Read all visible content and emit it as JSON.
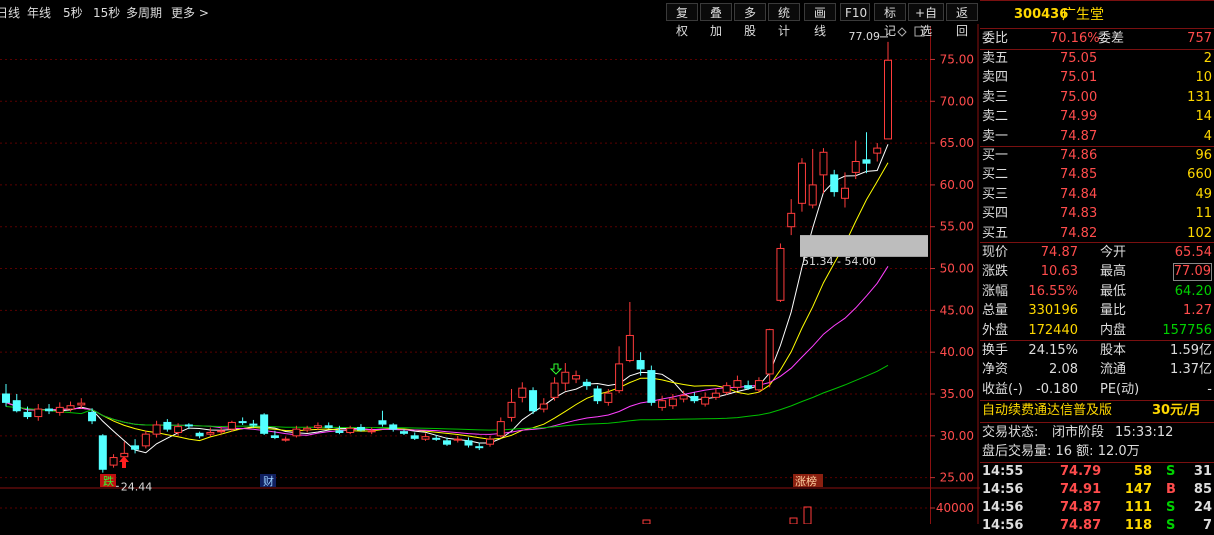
{
  "toolbar": {
    "periods": [
      "日线",
      "年线",
      "5秒",
      "15秒",
      "多周期",
      "更多 >"
    ],
    "buttons": [
      "复权",
      "叠加",
      "多股",
      "统计",
      "画线",
      "F10",
      "标记",
      "+自选",
      "返回"
    ]
  },
  "chart_data": {
    "type": "candlestick",
    "title": "",
    "ylim": [
      24,
      79
    ],
    "yticks": [
      25.0,
      30.0,
      35.0,
      40.0,
      45.0,
      50.0,
      55.0,
      60.0,
      65.0,
      70.0,
      75.0
    ],
    "candles": [
      [
        35.0,
        34.0,
        36.2,
        33.5
      ],
      [
        34.2,
        33.0,
        35.0,
        32.8
      ],
      [
        32.8,
        32.3,
        33.5,
        32.0
      ],
      [
        32.3,
        33.2,
        33.8,
        31.8
      ],
      [
        33.2,
        33.0,
        33.8,
        32.6
      ],
      [
        32.8,
        33.4,
        34.0,
        32.4
      ],
      [
        33.2,
        33.6,
        34.1,
        32.9
      ],
      [
        33.7,
        33.9,
        34.5,
        33.3
      ],
      [
        32.8,
        31.8,
        33.3,
        31.4
      ],
      [
        30.0,
        26.0,
        30.2,
        25.6
      ],
      [
        26.5,
        27.4,
        27.8,
        26.2
      ],
      [
        27.5,
        27.9,
        29.3,
        26.8
      ],
      [
        28.8,
        28.4,
        29.6,
        27.9
      ],
      [
        28.8,
        30.2,
        30.6,
        28.5
      ],
      [
        30.2,
        31.3,
        31.8,
        29.8
      ],
      [
        31.6,
        30.8,
        32.0,
        30.5
      ],
      [
        30.4,
        31.1,
        31.5,
        30.0
      ],
      [
        31.3,
        31.2,
        31.5,
        30.8
      ],
      [
        30.3,
        30.0,
        30.5,
        29.7
      ],
      [
        30.2,
        30.4,
        31.0,
        29.9
      ],
      [
        30.5,
        30.6,
        31.1,
        30.2
      ],
      [
        30.8,
        31.6,
        31.8,
        30.5
      ],
      [
        31.7,
        31.6,
        32.2,
        31.3
      ],
      [
        31.4,
        31.3,
        31.9,
        31.0
      ],
      [
        32.5,
        30.3,
        32.7,
        30.1
      ],
      [
        30.0,
        29.8,
        30.6,
        29.6
      ],
      [
        29.5,
        29.6,
        29.9,
        29.3
      ],
      [
        30.0,
        30.8,
        31.2,
        29.8
      ],
      [
        30.7,
        30.9,
        31.2,
        30.4
      ],
      [
        31.0,
        31.2,
        31.6,
        30.7
      ],
      [
        31.2,
        31.0,
        31.6,
        30.9
      ],
      [
        30.6,
        30.4,
        31.2,
        30.2
      ],
      [
        30.4,
        30.9,
        31.2,
        30.2
      ],
      [
        31.0,
        30.7,
        31.4,
        30.5
      ],
      [
        30.5,
        30.6,
        31.0,
        30.2
      ],
      [
        31.8,
        31.4,
        33.0,
        31.1
      ],
      [
        31.3,
        30.8,
        31.5,
        30.5
      ],
      [
        30.5,
        30.3,
        30.8,
        30.1
      ],
      [
        30.0,
        29.7,
        30.4,
        29.5
      ],
      [
        29.6,
        29.9,
        30.3,
        29.4
      ],
      [
        29.7,
        29.6,
        30.1,
        29.4
      ],
      [
        29.4,
        29.0,
        29.8,
        28.8
      ],
      [
        29.5,
        29.6,
        30.0,
        29.2
      ],
      [
        29.4,
        28.9,
        29.8,
        28.6
      ],
      [
        28.7,
        28.6,
        29.2,
        28.3
      ],
      [
        29.0,
        29.6,
        30.0,
        28.7
      ],
      [
        30.0,
        31.7,
        32.2,
        29.8
      ],
      [
        32.2,
        34.0,
        35.6,
        31.7
      ],
      [
        34.6,
        35.7,
        36.4,
        34.0
      ],
      [
        35.4,
        33.0,
        35.8,
        32.6
      ],
      [
        33.2,
        33.8,
        34.5,
        32.8
      ],
      [
        34.6,
        36.3,
        37.0,
        34.2
      ],
      [
        36.3,
        37.6,
        38.7,
        35.4
      ],
      [
        36.8,
        37.2,
        37.8,
        36.3
      ],
      [
        36.4,
        36.0,
        36.8,
        35.5
      ],
      [
        35.6,
        34.2,
        36.0,
        33.8
      ],
      [
        34.0,
        35.1,
        35.6,
        33.6
      ],
      [
        35.4,
        38.6,
        40.7,
        35.1
      ],
      [
        39.0,
        42.0,
        46.0,
        38.8
      ],
      [
        39.0,
        38.0,
        40.0,
        37.2
      ],
      [
        37.8,
        34.0,
        38.4,
        33.6
      ],
      [
        33.4,
        34.2,
        34.8,
        33.0
      ],
      [
        33.6,
        34.4,
        35.0,
        33.2
      ],
      [
        34.4,
        34.8,
        35.4,
        34.0
      ],
      [
        34.7,
        34.2,
        35.2,
        33.9
      ],
      [
        33.8,
        34.6,
        35.2,
        33.5
      ],
      [
        34.6,
        35.1,
        35.7,
        34.3
      ],
      [
        35.2,
        36.0,
        36.4,
        34.9
      ],
      [
        35.8,
        36.6,
        37.2,
        35.4
      ],
      [
        36.0,
        35.7,
        36.6,
        35.5
      ],
      [
        35.5,
        36.6,
        37.0,
        35.2
      ],
      [
        37.4,
        42.7,
        42.8,
        35.8
      ],
      [
        46.2,
        52.4,
        53.0,
        46.0
      ],
      [
        55.0,
        56.6,
        58.3,
        54.0
      ],
      [
        57.8,
        62.6,
        63.2,
        56.8
      ],
      [
        57.6,
        60.0,
        64.3,
        57.2
      ],
      [
        61.2,
        63.9,
        64.4,
        59.0
      ],
      [
        61.2,
        59.2,
        61.8,
        58.6
      ],
      [
        58.4,
        59.6,
        61.5,
        57.3
      ],
      [
        61.5,
        62.8,
        65.3,
        60.7
      ],
      [
        63.0,
        62.6,
        66.3,
        61.4
      ],
      [
        63.8,
        64.4,
        65.0,
        62.8
      ],
      [
        65.5,
        74.9,
        77.1,
        65.5
      ]
    ],
    "price_annotations": {
      "high": "77.09",
      "low": "24.44",
      "range": "51.34 - 54.00"
    },
    "markers": [
      "跌",
      "财",
      "涨榜"
    ],
    "volume_tick": "40000"
  },
  "panel": {
    "code": "300436",
    "name": "广生堂",
    "weibi_label": "委比",
    "weibi_value": "70.16%",
    "weicha_label": "委差",
    "weicha_value": "757",
    "sell": [
      {
        "label": "卖五",
        "price": "75.05",
        "vol": "2"
      },
      {
        "label": "卖四",
        "price": "75.01",
        "vol": "10"
      },
      {
        "label": "卖三",
        "price": "75.00",
        "vol": "131"
      },
      {
        "label": "卖二",
        "price": "74.99",
        "vol": "14"
      },
      {
        "label": "卖一",
        "price": "74.87",
        "vol": "4"
      }
    ],
    "buy": [
      {
        "label": "买一",
        "price": "74.86",
        "vol": "96"
      },
      {
        "label": "买二",
        "price": "74.85",
        "vol": "660"
      },
      {
        "label": "买三",
        "price": "74.84",
        "vol": "49"
      },
      {
        "label": "买四",
        "price": "74.83",
        "vol": "11"
      },
      {
        "label": "买五",
        "price": "74.82",
        "vol": "102"
      }
    ],
    "stats": [
      {
        "l1": "现价",
        "v1": "74.87",
        "l2": "今开",
        "v2": "65.54"
      },
      {
        "l1": "涨跌",
        "v1": "10.63",
        "l2": "最高",
        "v2": "77.09"
      },
      {
        "l1": "涨幅",
        "v1": "16.55%",
        "l2": "最低",
        "v2": "64.20"
      },
      {
        "l1": "总量",
        "v1": "330196",
        "l2": "量比",
        "v2": "1.27"
      },
      {
        "l1": "外盘",
        "v1": "172440",
        "l2": "内盘",
        "v2": "157756"
      }
    ],
    "stats2": [
      {
        "l1": "换手",
        "v1": "24.15%",
        "l2": "股本",
        "v2": "1.59亿"
      },
      {
        "l1": "净资",
        "v1": "2.08",
        "l2": "流通",
        "v2": "1.37亿"
      },
      {
        "l1": "收益(-)",
        "v1": "-0.180",
        "l2": "PE(动)",
        "v2": "-"
      }
    ],
    "promo_text": "自动续费通达信普及版",
    "promo_price": "30元/月",
    "trade_state_label": "交易状态:",
    "trade_state_value": "闭市阶段",
    "trade_state_time": "15:33:12",
    "after_hours": "盘后交易量: 16  额: 12.0万",
    "ticks": [
      {
        "time": "14:55",
        "price": "74.79",
        "vol": "58",
        "bs": "S",
        "n": "31"
      },
      {
        "time": "14:56",
        "price": "74.91",
        "vol": "147",
        "bs": "B",
        "n": "85"
      },
      {
        "time": "14:56",
        "price": "74.87",
        "vol": "111",
        "bs": "S",
        "n": "24"
      },
      {
        "time": "14:56",
        "price": "74.87",
        "vol": "118",
        "bs": "S",
        "n": "7"
      }
    ]
  }
}
